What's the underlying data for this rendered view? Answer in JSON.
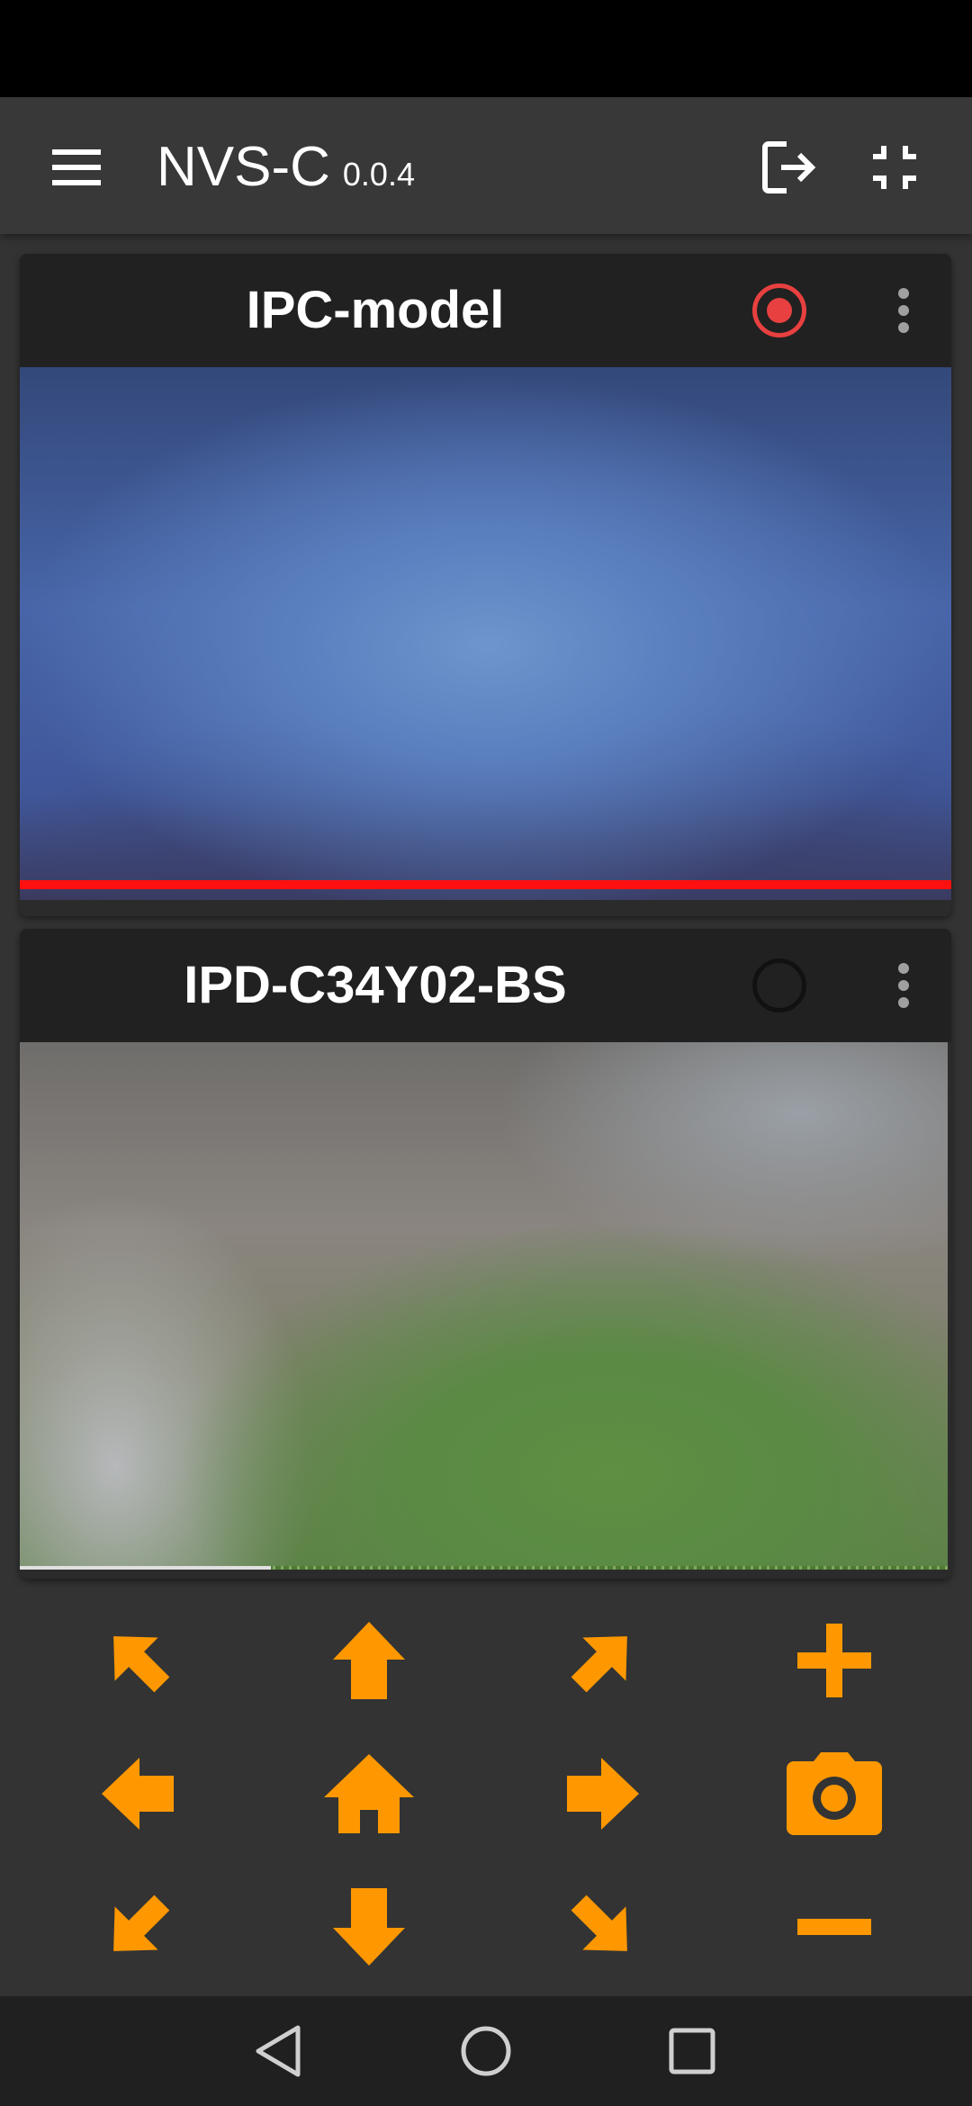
{
  "app_bar": {
    "title": "NVS-C",
    "version": "0.0.4",
    "icons": [
      "menu-icon",
      "logout-icon",
      "collapse-icon"
    ]
  },
  "cameras": [
    {
      "title": "IPC-model",
      "recording": true,
      "record_color": "#e84040",
      "progress_color": "#ff1010",
      "progress_fraction": 1.0
    },
    {
      "title": "IPD-C34Y02-BS",
      "recording": false,
      "progress_color": "#e0e0e0",
      "progress_fraction": 0.27
    }
  ],
  "ptz": {
    "accent_color": "#ff9800",
    "buttons": [
      "arrow-up-left-icon",
      "arrow-up-icon",
      "arrow-up-right-icon",
      "zoom-in-icon",
      "arrow-left-icon",
      "home-icon",
      "arrow-right-icon",
      "camera-snapshot-icon",
      "arrow-down-left-icon",
      "arrow-down-icon",
      "arrow-down-right-icon",
      "zoom-out-icon"
    ]
  },
  "nav_bar": {
    "icons": [
      "back-icon",
      "home-circle-icon",
      "recents-icon"
    ]
  }
}
